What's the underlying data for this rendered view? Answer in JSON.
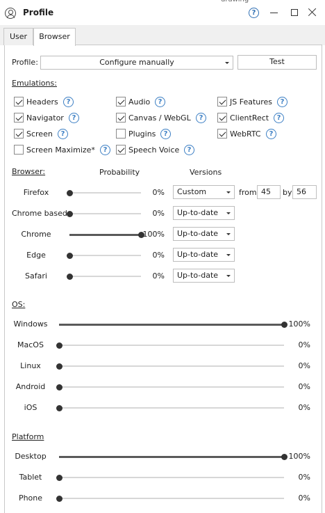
{
  "window": {
    "title": "Profile",
    "bg_text": "drawing"
  },
  "tabs": [
    {
      "label": "User"
    },
    {
      "label": "Browser"
    }
  ],
  "profile": {
    "label": "Profile:",
    "value": "Configure manually",
    "test_label": "Test"
  },
  "emulations": {
    "title": "Emulations:",
    "items": [
      {
        "label": "Headers",
        "checked": true
      },
      {
        "label": "Audio",
        "checked": true
      },
      {
        "label": "JS Features",
        "checked": true
      },
      {
        "label": "Navigator",
        "checked": true
      },
      {
        "label": "Canvas / WebGL",
        "checked": true
      },
      {
        "label": "ClientRect",
        "checked": true
      },
      {
        "label": "Screen",
        "checked": true
      },
      {
        "label": "Plugins",
        "checked": false
      },
      {
        "label": "WebRTC",
        "checked": true
      },
      {
        "label": "Screen Maximize*",
        "checked": false
      },
      {
        "label": "Speech Voice",
        "checked": true
      }
    ]
  },
  "browser": {
    "title": "Browser:",
    "col_probability": "Probability",
    "col_versions": "Versions",
    "rows": [
      {
        "name": "Firefox",
        "value": 0,
        "pct": "0%",
        "version": "Custom",
        "from_label": "from",
        "from": "45",
        "by_label": "by",
        "by": "56"
      },
      {
        "name": "Chrome based",
        "value": 0,
        "pct": "0%",
        "version": "Up-to-date"
      },
      {
        "name": "Chrome",
        "value": 100,
        "pct": "100%",
        "version": "Up-to-date"
      },
      {
        "name": "Edge",
        "value": 0,
        "pct": "0%",
        "version": "Up-to-date"
      },
      {
        "name": "Safari",
        "value": 0,
        "pct": "0%",
        "version": "Up-to-date"
      }
    ]
  },
  "os": {
    "title": "OS:",
    "rows": [
      {
        "name": "Windows",
        "value": 100,
        "pct": "100%"
      },
      {
        "name": "MacOS",
        "value": 0,
        "pct": "0%"
      },
      {
        "name": "Linux",
        "value": 0,
        "pct": "0%"
      },
      {
        "name": "Android",
        "value": 0,
        "pct": "0%"
      },
      {
        "name": "iOS",
        "value": 0,
        "pct": "0%"
      }
    ]
  },
  "platform": {
    "title": "Platform",
    "rows": [
      {
        "name": "Desktop",
        "value": 100,
        "pct": "100%"
      },
      {
        "name": "Tablet",
        "value": 0,
        "pct": "0%"
      },
      {
        "name": "Phone",
        "value": 0,
        "pct": "0%"
      }
    ]
  },
  "help_glyph": "?",
  "colors": {
    "help": "#3c7fc4",
    "knob": "#333333",
    "track": "#d7d7d7"
  }
}
